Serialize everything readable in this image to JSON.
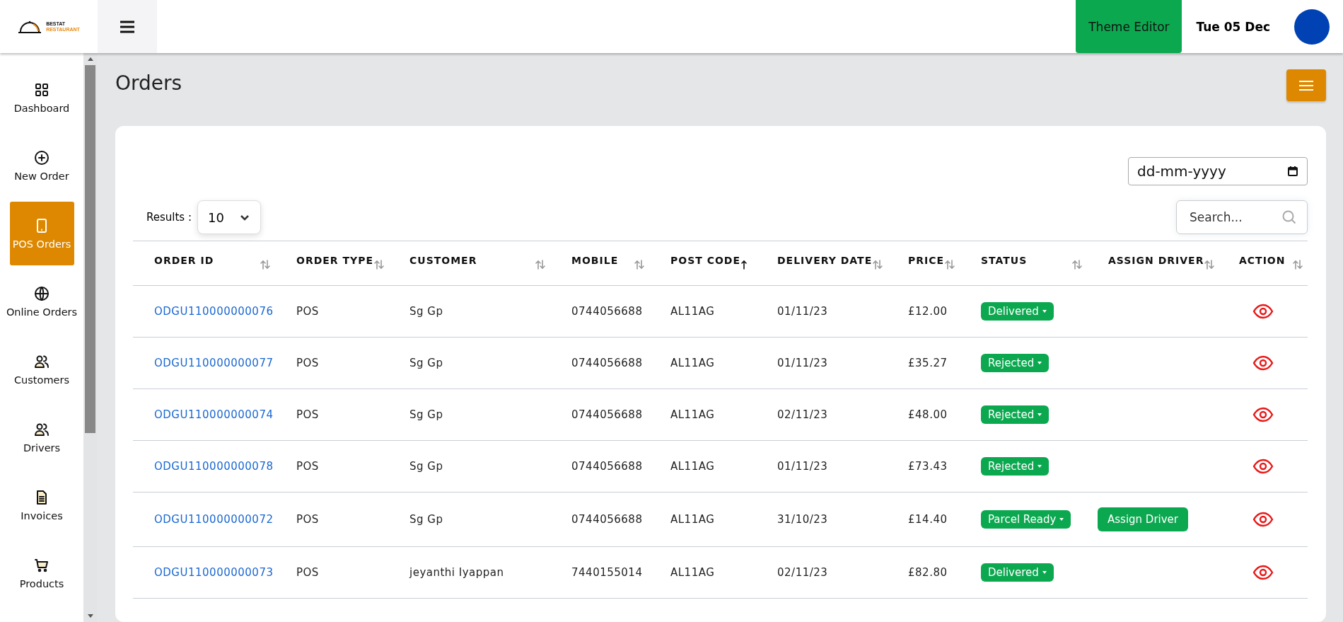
{
  "header": {
    "logo": {
      "line_1": "BESTAT",
      "line_2": "RESTAURANT"
    },
    "theme_button": "Theme Editor",
    "date": "Tue 05 Dec"
  },
  "sidebar": {
    "items": [
      {
        "label": "Dashboard",
        "selected": false
      },
      {
        "label": "New Order",
        "selected": false
      },
      {
        "label": "POS Orders",
        "selected": true
      },
      {
        "label": "Online Orders",
        "selected": false
      },
      {
        "label": "Customers",
        "selected": false
      },
      {
        "label": "Drivers",
        "selected": false
      },
      {
        "label": "Invoices",
        "selected": false
      },
      {
        "label": "Products",
        "selected": false
      }
    ]
  },
  "page": {
    "title": "Orders"
  },
  "filters": {
    "date_placeholder": "dd-mm-yyyy",
    "results_label": "Results :",
    "results_value": "10",
    "search_placeholder": "Search..."
  },
  "table": {
    "columns": [
      {
        "label": "ORDER ID",
        "sorted": false
      },
      {
        "label": "ORDER TYPE",
        "sorted": false
      },
      {
        "label": "CUSTOMER",
        "sorted": false
      },
      {
        "label": "MOBILE",
        "sorted": false
      },
      {
        "label": "POST CODE",
        "sorted": true
      },
      {
        "label": "DELIVERY DATE",
        "sorted": false
      },
      {
        "label": "PRICE",
        "sorted": false
      },
      {
        "label": "STATUS",
        "sorted": false
      },
      {
        "label": "ASSIGN DRIVER",
        "sorted": false
      },
      {
        "label": "ACTION",
        "sorted": false
      }
    ],
    "rows": [
      {
        "order_id": "ODGU110000000076",
        "order_type": "POS",
        "customer": "Sg Gp",
        "mobile": "0744056688",
        "post_code": "AL11AG",
        "delivery_date": "01/11/23",
        "price": "£12.00",
        "status": "Delivered"
      },
      {
        "order_id": "ODGU110000000077",
        "order_type": "POS",
        "customer": "Sg Gp",
        "mobile": "0744056688",
        "post_code": "AL11AG",
        "delivery_date": "01/11/23",
        "price": "£35.27",
        "status": "Rejected"
      },
      {
        "order_id": "ODGU110000000074",
        "order_type": "POS",
        "customer": "Sg Gp",
        "mobile": "0744056688",
        "post_code": "AL11AG",
        "delivery_date": "02/11/23",
        "price": "£48.00",
        "status": "Rejected"
      },
      {
        "order_id": "ODGU110000000078",
        "order_type": "POS",
        "customer": "Sg Gp",
        "mobile": "0744056688",
        "post_code": "AL11AG",
        "delivery_date": "01/11/23",
        "price": "£73.43",
        "status": "Rejected"
      },
      {
        "order_id": "ODGU110000000072",
        "order_type": "POS",
        "customer": "Sg Gp",
        "mobile": "0744056688",
        "post_code": "AL11AG",
        "delivery_date": "31/10/23",
        "price": "£14.40",
        "status": "Parcel Ready",
        "assign_driver": "Assign Driver"
      },
      {
        "order_id": "ODGU110000000073",
        "order_type": "POS",
        "customer": "jeyanthi Iyappan",
        "mobile": "7440155014",
        "post_code": "AL11AG",
        "delivery_date": "02/11/23",
        "price": "£82.80",
        "status": "Delivered"
      }
    ]
  }
}
